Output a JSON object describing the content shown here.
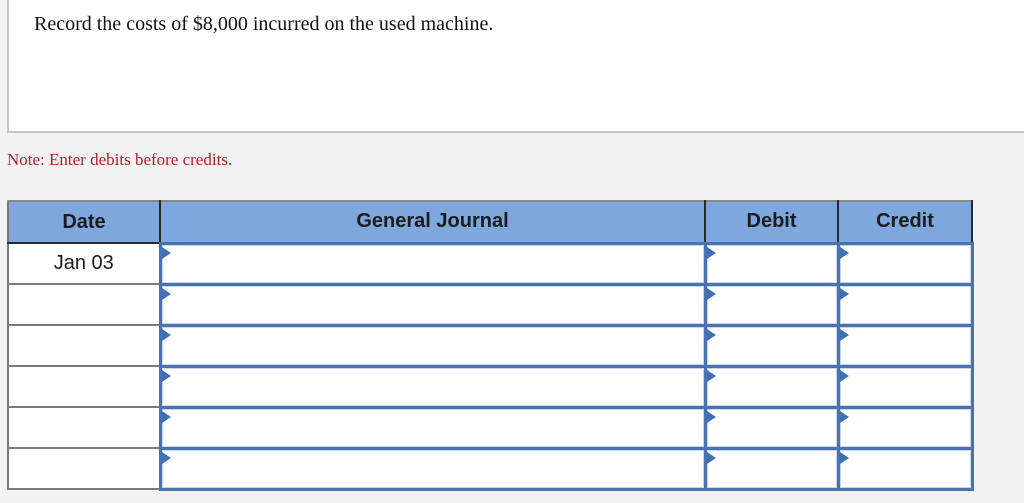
{
  "prompt": {
    "text": "Record the costs of $8,000 incurred on the used machine."
  },
  "note": "Note: Enter debits before credits.",
  "journal": {
    "headers": {
      "date": "Date",
      "general_journal": "General Journal",
      "debit": "Debit",
      "credit": "Credit"
    },
    "rows": [
      {
        "date": "Jan 03",
        "account": "",
        "debit": "",
        "credit": ""
      },
      {
        "date": "",
        "account": "",
        "debit": "",
        "credit": ""
      },
      {
        "date": "",
        "account": "",
        "debit": "",
        "credit": ""
      },
      {
        "date": "",
        "account": "",
        "debit": "",
        "credit": ""
      },
      {
        "date": "",
        "account": "",
        "debit": "",
        "credit": ""
      },
      {
        "date": "",
        "account": "",
        "debit": "",
        "credit": ""
      }
    ]
  },
  "colors": {
    "header_bg": "#7ea7dd",
    "note_text": "#a6282a",
    "input_border": "#4a72b0",
    "marker": "#3f6fb8"
  }
}
